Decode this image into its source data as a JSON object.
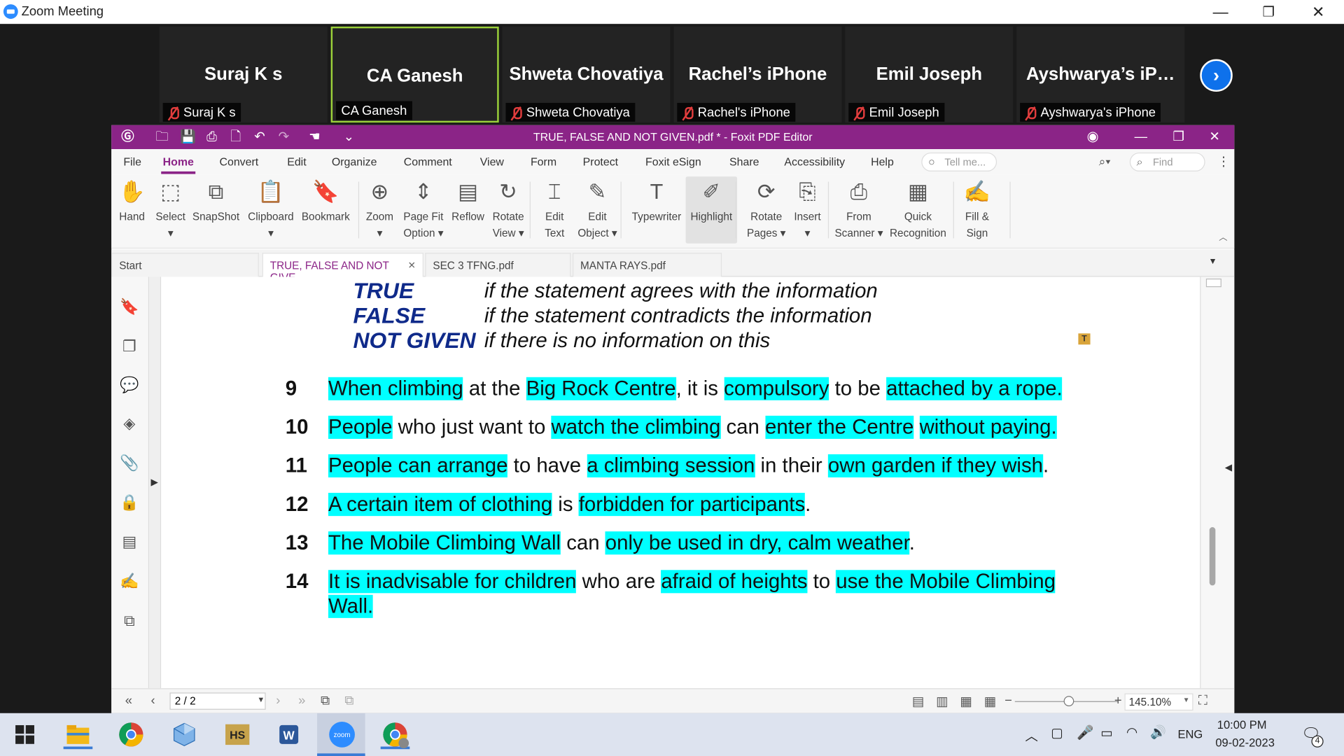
{
  "window": {
    "title": "Zoom Meeting",
    "minimize": "—",
    "restore": "❐",
    "close": "✕"
  },
  "gallery": {
    "tiles": [
      {
        "name": "Suraj K s",
        "label": "Suraj K s",
        "muted": true,
        "active": false
      },
      {
        "name": "CA Ganesh",
        "label": "CA Ganesh",
        "muted": false,
        "active": true
      },
      {
        "name": "Shweta Chovatiya",
        "label": "Shweta Chovatiya",
        "muted": true,
        "active": false
      },
      {
        "name": "Rachel’s iPhone",
        "label": "Rachel's iPhone",
        "muted": true,
        "active": false
      },
      {
        "name": "Emil Joseph",
        "label": "Emil Joseph",
        "muted": true,
        "active": false
      },
      {
        "name": "Ayshwarya’s  iP…",
        "label": "Ayshwarya's iPhone",
        "muted": true,
        "active": false
      }
    ],
    "next": "›"
  },
  "foxit": {
    "title": "TRUE, FALSE AND NOT GIVEN.pdf * - Foxit PDF Editor",
    "menus": [
      "File",
      "Home",
      "Convert",
      "Edit",
      "Organize",
      "Comment",
      "View",
      "Form",
      "Protect",
      "Foxit eSign",
      "Share",
      "Accessibility",
      "Help"
    ],
    "selected_menu": "Home",
    "tellme": "Tell me...",
    "find": "Find",
    "tools": [
      {
        "icon": "✋",
        "l1": "Hand",
        "l2": ""
      },
      {
        "icon": "⬚",
        "l1": "Select",
        "l2": "▾"
      },
      {
        "icon": "⧉",
        "l1": "SnapShot",
        "l2": ""
      },
      {
        "icon": "📋",
        "l1": "Clipboard",
        "l2": "▾"
      },
      {
        "icon": "🔖",
        "l1": "Bookmark",
        "l2": ""
      },
      {
        "icon": "⊕",
        "l1": "Zoom",
        "l2": "▾"
      },
      {
        "icon": "⇕",
        "l1": "Page Fit",
        "l2": "Option ▾"
      },
      {
        "icon": "▤",
        "l1": "Reflow",
        "l2": ""
      },
      {
        "icon": "↻",
        "l1": "Rotate",
        "l2": "View ▾"
      },
      {
        "icon": "⌶",
        "l1": "Edit",
        "l2": "Text"
      },
      {
        "icon": "✎",
        "l1": "Edit",
        "l2": "Object ▾"
      },
      {
        "icon": "T",
        "l1": "Typewriter",
        "l2": ""
      },
      {
        "icon": "✐",
        "l1": "Highlight",
        "l2": ""
      },
      {
        "icon": "⟳",
        "l1": "Rotate",
        "l2": "Pages ▾"
      },
      {
        "icon": "⎘",
        "l1": "Insert",
        "l2": "▾"
      },
      {
        "icon": "⎙",
        "l1": "From",
        "l2": "Scanner ▾"
      },
      {
        "icon": "▦",
        "l1": "Quick",
        "l2": "Recognition"
      },
      {
        "icon": "✍",
        "l1": "Fill &",
        "l2": "Sign"
      }
    ],
    "doc_tabs": [
      "Start",
      "TRUE, FALSE AND NOT GIVE...",
      "SEC 3 TFNG.pdf",
      "MANTA RAYS.pdf"
    ],
    "tab_close": "✕",
    "page_nav": "2 / 2",
    "zoom": "145.10%"
  },
  "document": {
    "legend": [
      {
        "key": "TRUE",
        "desc": "if the statement agrees with the information"
      },
      {
        "key": "FALSE",
        "desc": "if the statement contradicts the information"
      },
      {
        "key": "NOT GIVEN",
        "desc": "if there is no information on this"
      }
    ],
    "questions": [
      {
        "num": "9",
        "line1": [
          [
            "When climbing",
            true
          ],
          [
            " at the ",
            false
          ],
          [
            "Big Rock Centre",
            true
          ],
          [
            ", it is ",
            false
          ],
          [
            "compulsory",
            true
          ],
          [
            " to be ",
            false
          ],
          [
            "attached by a rope.",
            true
          ]
        ]
      },
      {
        "num": "10",
        "line1": [
          [
            "People",
            true
          ],
          [
            " who just want to ",
            false
          ],
          [
            "watch the climbing",
            true
          ],
          [
            " can ",
            false
          ],
          [
            "enter the Centre",
            true
          ],
          [
            " ",
            false
          ],
          [
            "without paying.",
            true
          ]
        ]
      },
      {
        "num": "11",
        "line1": [
          [
            "People can arrange",
            true
          ],
          [
            " to have ",
            false
          ],
          [
            "a climbing session",
            true
          ],
          [
            " in their ",
            false
          ],
          [
            "own garden if they wish",
            true
          ],
          [
            ".",
            false
          ]
        ]
      },
      {
        "num": "12",
        "line1": [
          [
            "A certain item of clothing",
            true
          ],
          [
            " is ",
            false
          ],
          [
            "forbidden for participants",
            true
          ],
          [
            ".",
            false
          ]
        ]
      },
      {
        "num": "13",
        "line1": [
          [
            "The Mobile Climbing Wall",
            true
          ],
          [
            " can ",
            false
          ],
          [
            "only be used in dry, calm weather",
            true
          ],
          [
            ".",
            false
          ]
        ]
      },
      {
        "num": "14",
        "line1": [
          [
            "It is inadvisable for children",
            true
          ],
          [
            " who are ",
            false
          ],
          [
            "afraid of heights",
            true
          ],
          [
            " to ",
            false
          ],
          [
            "use the Mobile Climbing",
            true
          ]
        ],
        "line2": [
          [
            "Wall.",
            true
          ]
        ]
      }
    ]
  },
  "taskbar": {
    "lang": "ENG",
    "time": "10:00 PM",
    "date": "09-02-2023",
    "notifications": "4"
  }
}
